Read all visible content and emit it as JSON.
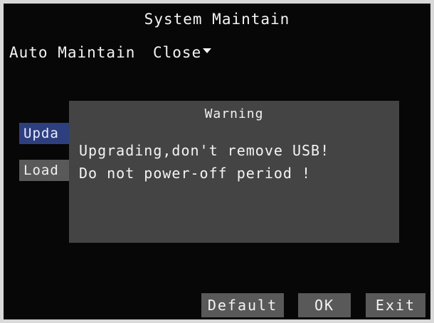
{
  "header": {
    "title": "System Maintain"
  },
  "settings": {
    "auto_maintain_label": "Auto Maintain",
    "auto_maintain_value": "Close"
  },
  "side_buttons": {
    "update_label": "Upda",
    "load_label": "Load"
  },
  "dialog": {
    "title": "Warning",
    "lines": [
      "Upgrading,don't remove USB!",
      "Do not power-off period !"
    ]
  },
  "footer": {
    "default_label": "Default",
    "ok_label": "OK",
    "exit_label": "Exit"
  },
  "colors": {
    "screen_background": "#070707",
    "dialog_background": "#444444",
    "selected_button": "#2e3f80",
    "button_gray": "#595959",
    "text": "#f2f2f2"
  }
}
